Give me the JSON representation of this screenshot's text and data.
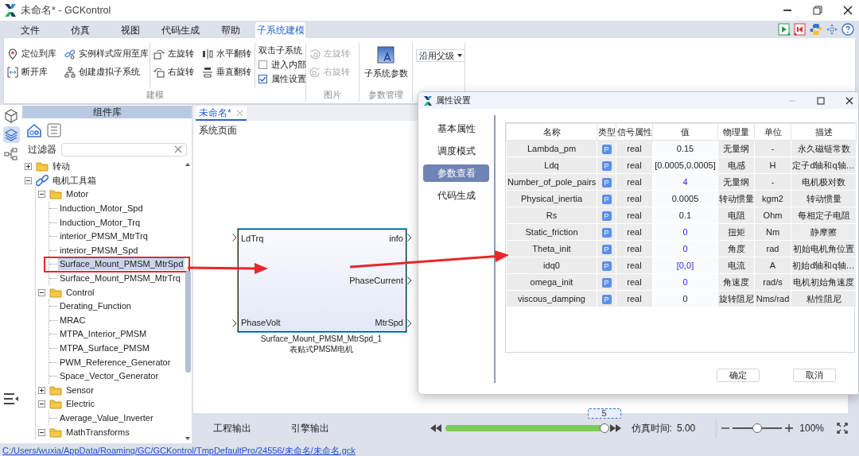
{
  "window": {
    "title": "未命名* - GCKontrol"
  },
  "menu_tabs": [
    {
      "label": "文件",
      "selected": false
    },
    {
      "label": "仿真",
      "selected": false
    },
    {
      "label": "视图",
      "selected": false
    },
    {
      "label": "代码生成",
      "selected": false
    },
    {
      "label": "帮助",
      "selected": false
    },
    {
      "label": "子系统建模",
      "selected": true
    }
  ],
  "ribbon": {
    "groups": [
      {
        "kind": "buttons",
        "label": "建模",
        "sections": [
          {
            "kind": "buttons",
            "items": [
              {
                "label": "定位到库",
                "disabled": false
              },
              {
                "label": "实例样式应用至库",
                "disabled": false
              },
              {
                "label": "断开库",
                "disabled": false
              },
              {
                "label": "创建虚拟子系统",
                "disabled": false
              }
            ]
          },
          {
            "kind": "buttons",
            "items": [
              {
                "label": "左旋转",
                "disabled": false
              },
              {
                "label": "水平翻转",
                "disabled": false
              },
              {
                "label": "右旋转",
                "disabled": false
              },
              {
                "label": "垂直翻转",
                "disabled": false
              }
            ]
          },
          {
            "kind": "options",
            "title": "双击子系统",
            "items": [
              {
                "label": "进入内部",
                "checked": false
              },
              {
                "label": "属性设置",
                "checked": true
              }
            ]
          }
        ]
      },
      {
        "kind": "buttons",
        "label": "图片",
        "sections": [
          {
            "kind": "buttons",
            "items": [
              {
                "label": "左旋转",
                "disabled": true
              },
              {
                "label": "右旋转",
                "disabled": true
              }
            ]
          }
        ]
      },
      {
        "kind": "big_button",
        "label": "参数管理",
        "button": "子系统参数"
      },
      {
        "kind": "dropdown",
        "value": "沿用父级"
      }
    ]
  },
  "side_tabs": [
    {
      "selected": false
    },
    {
      "selected": true
    },
    {
      "selected": false
    }
  ],
  "library": {
    "title": "组件库",
    "filter_label": "过滤器",
    "tree": [
      {
        "label": "转动",
        "kind": "folder",
        "expanded": false
      },
      {
        "label": "电机工具箱",
        "kind": "toolbox",
        "expanded": true,
        "children": [
          {
            "label": "Motor",
            "kind": "folder",
            "expanded": true,
            "children": [
              {
                "label": "Induction_Motor_Spd",
                "kind": "block",
                "selected": false,
                "highlighted": false
              },
              {
                "label": "Induction_Motor_Trq",
                "kind": "block",
                "selected": false,
                "highlighted": false
              },
              {
                "label": "interior_PMSM_MtrTrq",
                "kind": "block",
                "selected": false,
                "highlighted": false
              },
              {
                "label": "interior_PMSM_Spd",
                "kind": "block",
                "selected": false,
                "highlighted": false
              },
              {
                "label": "Surface_Mount_PMSM_MtrSpd",
                "kind": "block",
                "selected": true,
                "highlighted": true
              },
              {
                "label": "Surface_Mount_PMSM_MtrTrq",
                "kind": "block",
                "selected": false,
                "highlighted": false
              }
            ]
          },
          {
            "label": "Control",
            "kind": "folder",
            "expanded": true,
            "children": [
              {
                "label": "Derating_Function",
                "kind": "block",
                "selected": false,
                "highlighted": false
              },
              {
                "label": "MRAC",
                "kind": "block",
                "selected": false,
                "highlighted": false
              },
              {
                "label": "MTPA_Interior_PMSM",
                "kind": "block",
                "selected": false,
                "highlighted": false
              },
              {
                "label": "MTPA_Surface_PMSM",
                "kind": "block",
                "selected": false,
                "highlighted": false
              },
              {
                "label": "PWM_Reference_Generator",
                "kind": "block",
                "selected": false,
                "highlighted": false
              },
              {
                "label": "Space_Vector_Generator",
                "kind": "block",
                "selected": false,
                "highlighted": false
              }
            ]
          },
          {
            "label": "Sensor",
            "kind": "folder",
            "expanded": false
          },
          {
            "label": "Electric",
            "kind": "folder",
            "expanded": true,
            "children": [
              {
                "label": "Average_Value_Inverter",
                "kind": "block",
                "selected": false,
                "highlighted": false
              }
            ]
          },
          {
            "label": "MathTransforms",
            "kind": "folder",
            "expanded": true
          }
        ]
      }
    ]
  },
  "canvas": {
    "tab": {
      "label": "未命名*",
      "selected": true
    },
    "page_label": "系统页面",
    "block": {
      "inputs": [
        "LdTrq",
        "PhaseVolt"
      ],
      "outputs": [
        "info",
        "PhaseCurrent",
        "MtrSpd"
      ],
      "name": "Surface_Mount_PMSM_MtrSpd_1",
      "caption": "表贴式PMSM电机"
    }
  },
  "dialog": {
    "title": "属性设置",
    "nav": [
      {
        "label": "基本属性",
        "selected": false
      },
      {
        "label": "调度模式",
        "selected": false
      },
      {
        "label": "参数查看",
        "selected": true
      },
      {
        "label": "代码生成",
        "selected": false
      }
    ],
    "table": {
      "columns": [
        "名称",
        "类型",
        "信号属性",
        "值",
        "物理量",
        "单位",
        "描述"
      ],
      "rows": [
        {
          "name": "Lambda_pm",
          "type": "P",
          "signal": "real",
          "value": "0.15",
          "modified": false,
          "quantity": "无量纲",
          "unit": "-",
          "description": "永久磁链常数"
        },
        {
          "name": "Ldq",
          "type": "P",
          "signal": "real",
          "value": "[0.0005,0.0005]",
          "modified": false,
          "quantity": "电感",
          "unit": "H",
          "description": "定子d轴和q轴…"
        },
        {
          "name": "Number_of_pole_pairs",
          "type": "P",
          "signal": "real",
          "value": "4",
          "modified": true,
          "quantity": "无量纲",
          "unit": "-",
          "description": "电机极对数"
        },
        {
          "name": "Physical_inertia",
          "type": "P",
          "signal": "real",
          "value": "0.0005",
          "modified": false,
          "quantity": "转动惯量",
          "unit": "kgm2",
          "description": "转动惯量"
        },
        {
          "name": "Rs",
          "type": "P",
          "signal": "real",
          "value": "0.1",
          "modified": false,
          "quantity": "电阻",
          "unit": "Ohm",
          "description": "每相定子电阻"
        },
        {
          "name": "Static_friction",
          "type": "P",
          "signal": "real",
          "value": "0",
          "modified": true,
          "quantity": "扭矩",
          "unit": "Nm",
          "description": "静摩擦"
        },
        {
          "name": "Theta_init",
          "type": "P",
          "signal": "real",
          "value": "0",
          "modified": true,
          "quantity": "角度",
          "unit": "rad",
          "description": "初始电机角位置"
        },
        {
          "name": "idq0",
          "type": "P",
          "signal": "real",
          "value": "[0,0]",
          "modified": true,
          "quantity": "电流",
          "unit": "A",
          "description": "初始d轴和q轴…"
        },
        {
          "name": "omega_init",
          "type": "P",
          "signal": "real",
          "value": "0",
          "modified": true,
          "quantity": "角速度",
          "unit": "rad/s",
          "description": "电机初始角速度"
        },
        {
          "name": "viscous_damping",
          "type": "P",
          "signal": "real",
          "value": "0",
          "modified": false,
          "quantity": "旋转阻尼",
          "unit": "Nms/rad",
          "description": "粘性阻尼"
        }
      ]
    },
    "buttons": [
      "确定",
      "取消"
    ]
  },
  "bottom_bar": {
    "output_tabs": [
      "工程输出",
      "引擎输出"
    ],
    "playback": {
      "level": 1.0,
      "step": "5"
    },
    "sim_time_label": "仿真时间:",
    "sim_time": "5.00",
    "zoom": {
      "level": 0.5,
      "value": "100%"
    }
  },
  "status_bar": {
    "path": "C:/Users/wuxia/AppData/Roaming/GC/GCKontrol/TmpDefaultPro/24556/未命名/未命名.gck"
  }
}
